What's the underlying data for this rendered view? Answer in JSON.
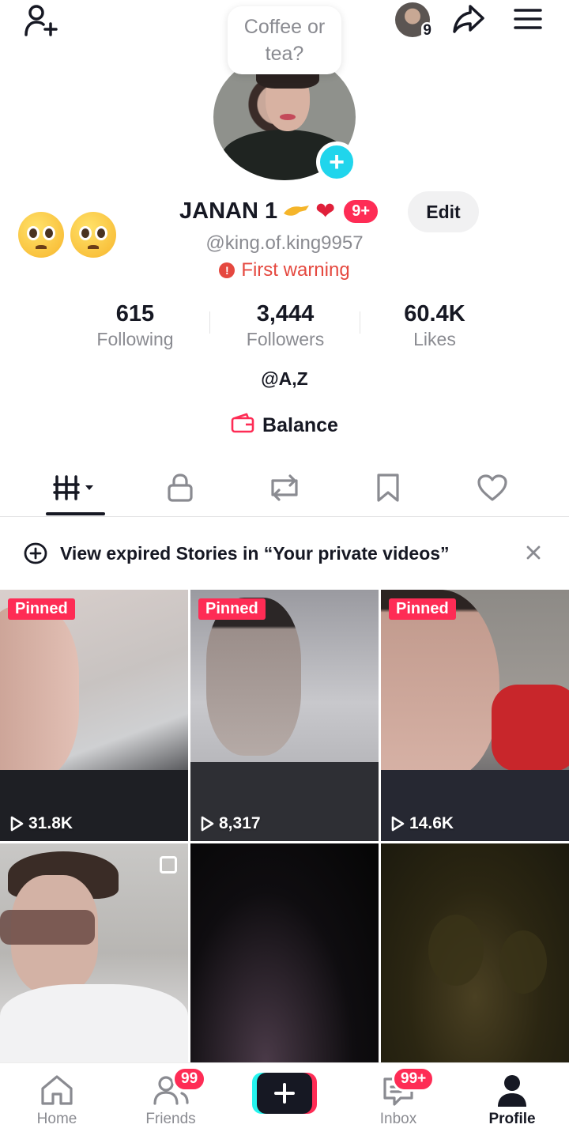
{
  "bubble": {
    "text": "Coffee or tea?"
  },
  "header": {
    "profile_switch_count": "9"
  },
  "profile": {
    "display_name": "JANAN 1",
    "notif_badge": "9+",
    "edit_label": "Edit",
    "handle": "@king.of.king9957",
    "warning": "First warning"
  },
  "stats": [
    {
      "value": "615",
      "label": "Following"
    },
    {
      "value": "3,444",
      "label": "Followers"
    },
    {
      "value": "60.4K",
      "label": "Likes"
    }
  ],
  "bio": "@A,Z",
  "balance_label": "Balance",
  "tabs": [
    "videos-grid-icon",
    "lock-icon",
    "repost-icon",
    "bookmark-icon",
    "heart-icon"
  ],
  "banner": {
    "text": "View expired Stories in “Your private videos”"
  },
  "videos": [
    {
      "pinned": "Pinned",
      "views": "31.8K"
    },
    {
      "pinned": "Pinned",
      "views": "8,317"
    },
    {
      "pinned": "Pinned",
      "views": "14.6K"
    },
    {
      "pinned": "",
      "views": ""
    },
    {
      "pinned": "",
      "views": ""
    },
    {
      "pinned": "",
      "views": ""
    }
  ],
  "nav": {
    "home": "Home",
    "friends": "Friends",
    "friends_badge": "99",
    "inbox": "Inbox",
    "inbox_badge": "99+",
    "profile": "Profile"
  },
  "colors": {
    "accent": "#fe2c55",
    "cyan": "#20d5ec",
    "text_secondary": "#8a8b91"
  }
}
